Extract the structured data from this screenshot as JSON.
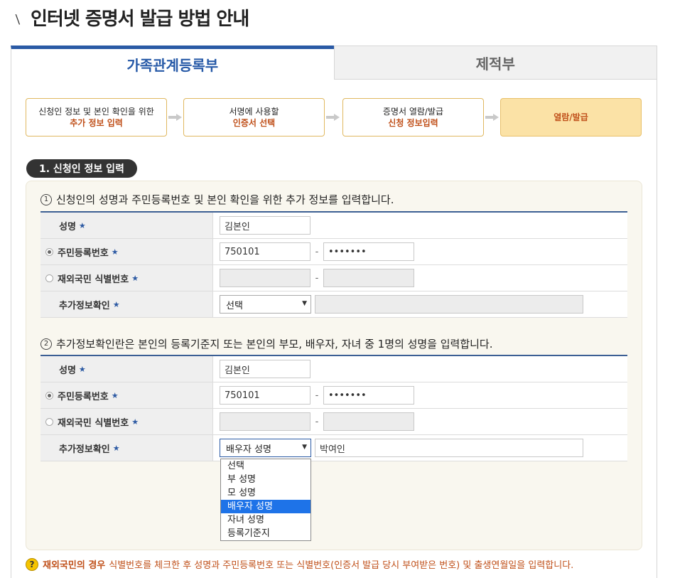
{
  "page": {
    "title": "인터넷 증명서 발급 방법 안내"
  },
  "tabs": [
    {
      "label": "가족관계등록부",
      "active": true
    },
    {
      "label": "제적부",
      "active": false
    }
  ],
  "steps": [
    {
      "line1": "신청인 정보 및 본인 확인을 위한",
      "line2": "추가 정보 입력"
    },
    {
      "line1": "서명에 사용할",
      "line2": "인증서 선택"
    },
    {
      "line1": "증명서 열람/발급",
      "line2": "신청 정보입력"
    },
    {
      "line1": "열람/발급",
      "line2": ""
    }
  ],
  "section": {
    "badge": "1. 신청인 정보 입력"
  },
  "instructions": [
    {
      "num": "1",
      "text": "신청인의 성명과 주민등록번호 및 본인 확인을 위한 추가 정보를 입력합니다."
    },
    {
      "num": "2",
      "text": "추가정보확인란은 본인의 등록기준지 또는 본인의 부모, 배우자, 자녀 중 1명의 성명을 입력합니다."
    }
  ],
  "labels": {
    "name": "성명",
    "rrn": "주민등록번호",
    "foreign_id": "재외국민 식별번호",
    "extra": "추가정보확인",
    "star": "★",
    "dash": "-"
  },
  "form1": {
    "name_value": "김본인",
    "rrn_front": "750101",
    "rrn_back": "•••••••",
    "rrn_selected": true,
    "select_value": "선택",
    "extra_value": ""
  },
  "form2": {
    "name_value": "김본인",
    "rrn_front": "750101",
    "rrn_back": "•••••••",
    "rrn_selected": true,
    "select_value": "배우자 성명",
    "extra_value": "박여인"
  },
  "dropdown": {
    "options": [
      "선택",
      "부 성명",
      "모 성명",
      "배우자 성명",
      "자녀 성명",
      "등록기준지"
    ],
    "selected_index": 3
  },
  "note": {
    "icon": "question-icon",
    "bold": "재외국민의 경우",
    "text": "식별번호를 체크한 후 성명과 주민등록번호 또는 식별번호(인증서 발급 당시 부여받은 번호) 및 출생연월일을 입력합니다."
  },
  "colors": {
    "accent": "#2a5aa5",
    "highlight": "#c0501a",
    "step_current": "#fbe2a6",
    "dropdown_selected": "#1e73e8"
  }
}
